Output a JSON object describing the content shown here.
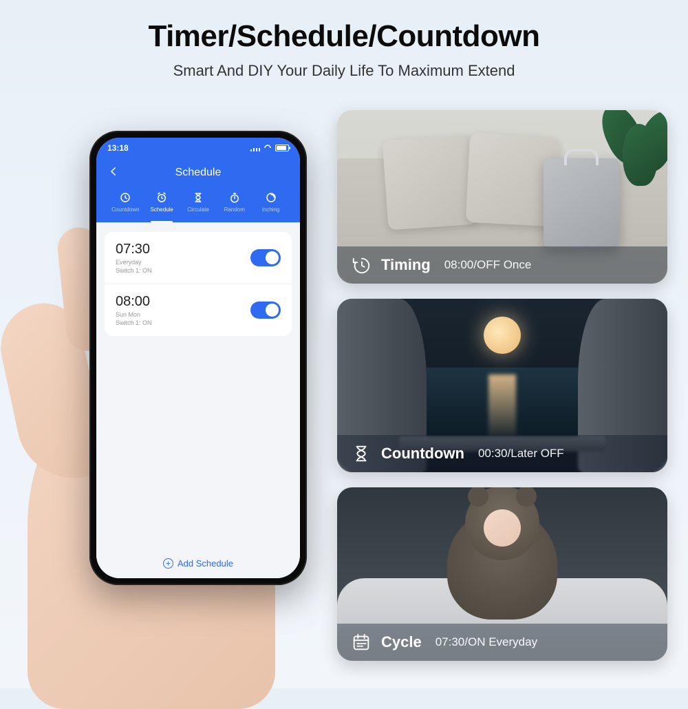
{
  "heading": {
    "title": "Timer/Schedule/Countdown",
    "subtitle": "Smart And DIY Your Daily Life To Maximum Extend"
  },
  "phone": {
    "status_time": "13:18",
    "header_title": "Schedule",
    "tabs": {
      "countdown": "Countdown",
      "schedule": "Schedule",
      "circulate": "Circulate",
      "random": "Random",
      "inching": "Inching"
    },
    "schedules": [
      {
        "time": "07:30",
        "days": "Everyday",
        "switch_line": "Switch 1: ON"
      },
      {
        "time": "08:00",
        "days": "Sun Mon",
        "switch_line": "Switch 1: ON"
      }
    ],
    "add_label": "Add Schedule"
  },
  "tiles": {
    "timing": {
      "label": "Timing",
      "detail": "08:00/OFF Once"
    },
    "countdown": {
      "label": "Countdown",
      "detail": "00:30/Later OFF"
    },
    "cycle": {
      "label": "Cycle",
      "detail": "07:30/ON Everyday"
    }
  }
}
